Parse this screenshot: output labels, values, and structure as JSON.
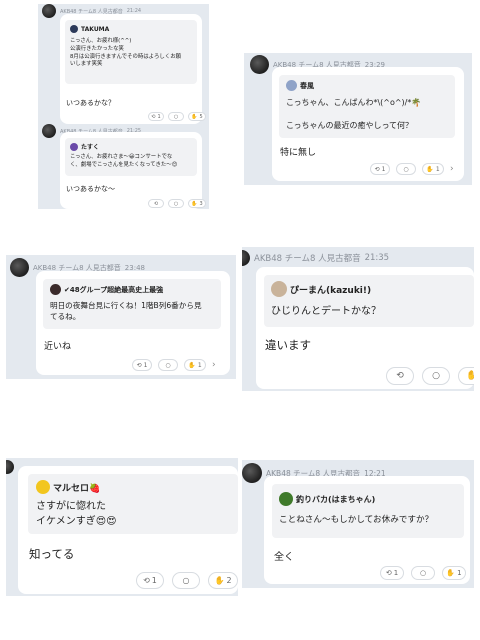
{
  "group_name": "AKB48 チーム8 人見古都音",
  "posts": [
    {
      "time": "21:24",
      "quote_author": "TAKUMA",
      "quote_text": "こっさん、お疲れ様(^^)\n公演行きたかったな笑\n8月は公演行きますんでその時はよろしくお願\nいします笑笑",
      "reply": "いつあるかな？",
      "retweet_count": "1",
      "like_count": "5"
    },
    {
      "time": "21:25",
      "quote_author": "たすく",
      "quote_text": "こっさん、お疲れさま〜😀コンサートでな\nく、劇場でこっさんを見たくなってきた〜😊",
      "reply": "いつあるかな〜",
      "retweet_count": "",
      "like_count": "3"
    },
    {
      "time": "23:29",
      "quote_author": "春風",
      "quote_text": "こっちゃん、こんばんわ*\\(^o^)/*🌴\n\nこっちゃんの最近の癒やしって何？",
      "reply": "特に無し",
      "retweet_count": "1",
      "like_count": "1"
    },
    {
      "time": "23:48",
      "quote_author": "✔48グループ超絶最高史上最強",
      "quote_text": "明日の夜舞台見に行くね！1階B列6番から見\nてるね。",
      "reply": "近いね",
      "retweet_count": "1",
      "like_count": "1"
    },
    {
      "time": "21:35",
      "quote_author": "ぴーまん(kazuki!)",
      "quote_text": "ひじりんとデートかな？",
      "reply": "違います",
      "retweet_count": "",
      "like_count": ""
    },
    {
      "time": "",
      "quote_author": "マルセロ🍓",
      "quote_text": "さすがに惚れた\nイケメンすぎ😍😍",
      "reply": "知ってる",
      "retweet_count": "1",
      "like_count": "2"
    },
    {
      "time": "12:21",
      "quote_author": "釣りバカ(はまちゃん)",
      "quote_text": "ことねさん〜もしかしてお休みですか？",
      "reply": "全く",
      "retweet_count": "1",
      "like_count": "1"
    }
  ],
  "icons": {
    "retweet": "⟲",
    "comment": "○",
    "like": "✋",
    "chevron": "›"
  },
  "colors": {
    "panel_bg": "#e4e9ef",
    "card_bg": "#ffffff",
    "quote_bg": "#f1f2f4",
    "header_text": "#8a9099"
  }
}
